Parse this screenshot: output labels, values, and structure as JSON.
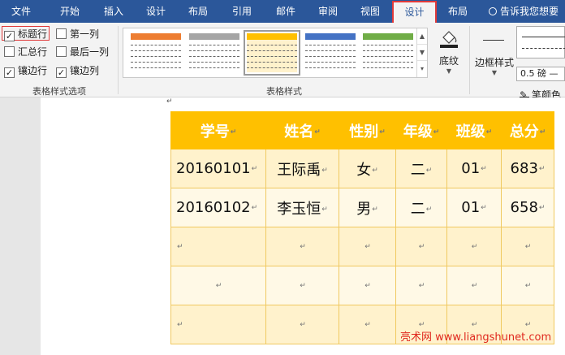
{
  "tabs": [
    {
      "label": "文件"
    },
    {
      "label": "开始"
    },
    {
      "label": "插入"
    },
    {
      "label": "设计"
    },
    {
      "label": "布局"
    },
    {
      "label": "引用"
    },
    {
      "label": "邮件"
    },
    {
      "label": "审阅"
    },
    {
      "label": "视图"
    },
    {
      "label": "设计"
    },
    {
      "label": "布局"
    }
  ],
  "tell_me": "告诉我您想要",
  "style_options": {
    "header_row": "标题行",
    "first_column": "第一列",
    "total_row": "汇总行",
    "last_column": "最后一列",
    "banded_rows": "镶边行",
    "banded_columns": "镶边列",
    "group_label": "表格样式选项",
    "checked": {
      "header_row": true,
      "first_column": false,
      "total_row": false,
      "last_column": false,
      "banded_rows": true,
      "banded_columns": true
    }
  },
  "table_styles": {
    "group_label": "表格样式",
    "thumb_colors": [
      "#ed7d31",
      "#a5a5a5",
      "#ffc000",
      "#4472c4",
      "#70ad47"
    ],
    "selected_index": 2
  },
  "shading": {
    "label": "底纹"
  },
  "borders": {
    "border_styles_label": "边框样式",
    "weight": "0.5 磅",
    "pen_color_label": "笔颜色"
  },
  "document_table": {
    "headers": [
      "学号",
      "姓名",
      "性别",
      "年级",
      "班级",
      "总分"
    ],
    "rows": [
      [
        "20160101",
        "王际禹",
        "女",
        "二",
        "01",
        "683"
      ],
      [
        "20160102",
        "李玉恒",
        "男",
        "二",
        "01",
        "658"
      ],
      [
        "",
        "",
        "",
        "",
        "",
        ""
      ],
      [
        "",
        "",
        "",
        "",
        "",
        ""
      ],
      [
        "",
        "",
        "",
        "",
        "",
        ""
      ]
    ],
    "header_color": "#ffc000",
    "band_color": "#fff2cc"
  },
  "paragraph_mark": "↵",
  "watermark": "亮术网 www.liangshunet.com"
}
